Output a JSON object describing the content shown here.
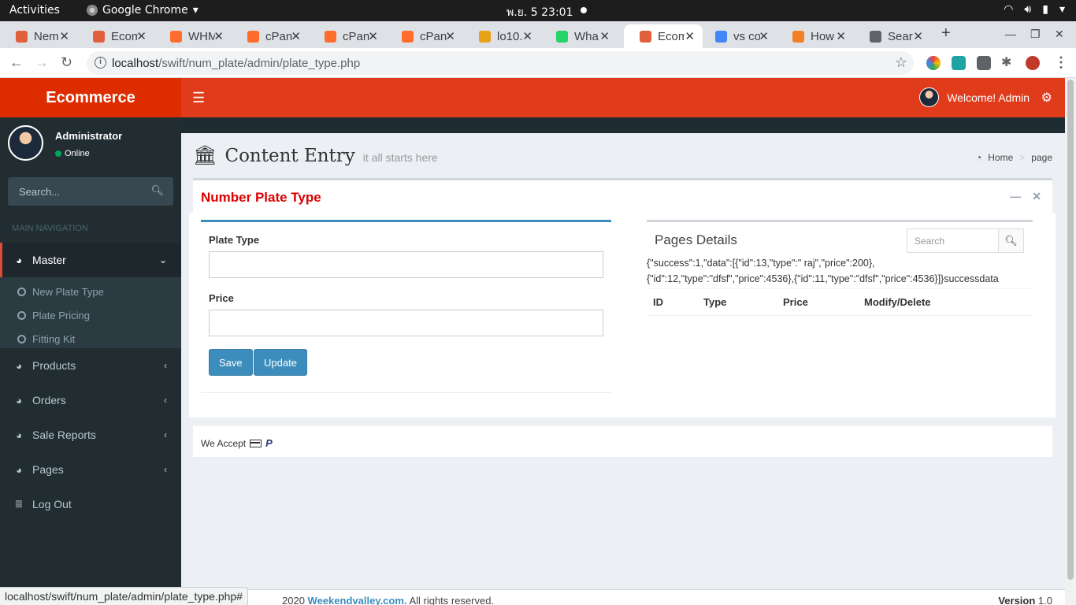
{
  "os": {
    "activities": "Activities",
    "app_name": "Google Chrome",
    "app_arrow": "▾",
    "clock": "พ.ย. 5  23:01"
  },
  "browser": {
    "tabs": [
      {
        "title": "Nem",
        "fav": "#e0603b"
      },
      {
        "title": "Ecom",
        "fav": "#e0603b"
      },
      {
        "title": "WHM",
        "fav": "#ff6c2c"
      },
      {
        "title": "cPan",
        "fav": "#ff6c2c"
      },
      {
        "title": "cPan",
        "fav": "#ff6c2c"
      },
      {
        "title": "cPan",
        "fav": "#ff6c2c"
      },
      {
        "title": "lo10.",
        "fav": "#e8a21a"
      },
      {
        "title": "Wha",
        "fav": "#25d366"
      },
      {
        "title": "Ecom",
        "fav": "#e0603b"
      },
      {
        "title": "vs co",
        "fav": "#4285f4"
      },
      {
        "title": "How",
        "fav": "#f48024"
      },
      {
        "title": "Sear",
        "fav": "#5f6368"
      }
    ],
    "url_host": "localhost",
    "url_path": "/swift/num_plate/admin/plate_type.php",
    "status_url": "localhost/swift/num_plate/admin/plate_type.php#"
  },
  "header": {
    "logo": "Ecommerce",
    "welcome": "Welcome! Admin"
  },
  "sidebar": {
    "user_name": "Administrator",
    "user_status": "Online",
    "search_placeholder": "Search...",
    "section_label": "MAIN NAVIGATION",
    "master_label": "Master",
    "sub_items": [
      "New Plate Type",
      "Plate Pricing",
      "Fitting Kit"
    ],
    "items": [
      "Products",
      "Orders",
      "Sale Reports",
      "Pages"
    ],
    "logout": "Log Out"
  },
  "page": {
    "title": "Content Entry",
    "subtitle": "it all starts here",
    "breadcrumb_home": "Home",
    "breadcrumb_sep": ">",
    "breadcrumb_page": "page"
  },
  "box": {
    "title": "Number Plate Type"
  },
  "form": {
    "plate_type_label": "Plate Type",
    "plate_type_value": "",
    "price_label": "Price",
    "price_value": "",
    "save_label": "Save",
    "update_label": "Update"
  },
  "details": {
    "title": "Pages Details",
    "search_placeholder": "Search",
    "json_line1": "{\"success\":1,\"data\":[{\"id\":13,\"type\":\" raj\",\"price\":200},",
    "json_line2": "{\"id\":12,\"type\":\"dfsf\",\"price\":4536},{\"id\":11,\"type\":\"dfsf\",\"price\":4536}]}successdata",
    "columns": [
      "ID",
      "Type",
      "Price",
      "Modify/Delete"
    ]
  },
  "footer": {
    "we_accept": "We Accept",
    "copyright_prefix": "2020",
    "site_link": "Weekendvalley.com.",
    "rights": "All rights reserved.",
    "version_label": "Version",
    "version_value": "1.0"
  }
}
